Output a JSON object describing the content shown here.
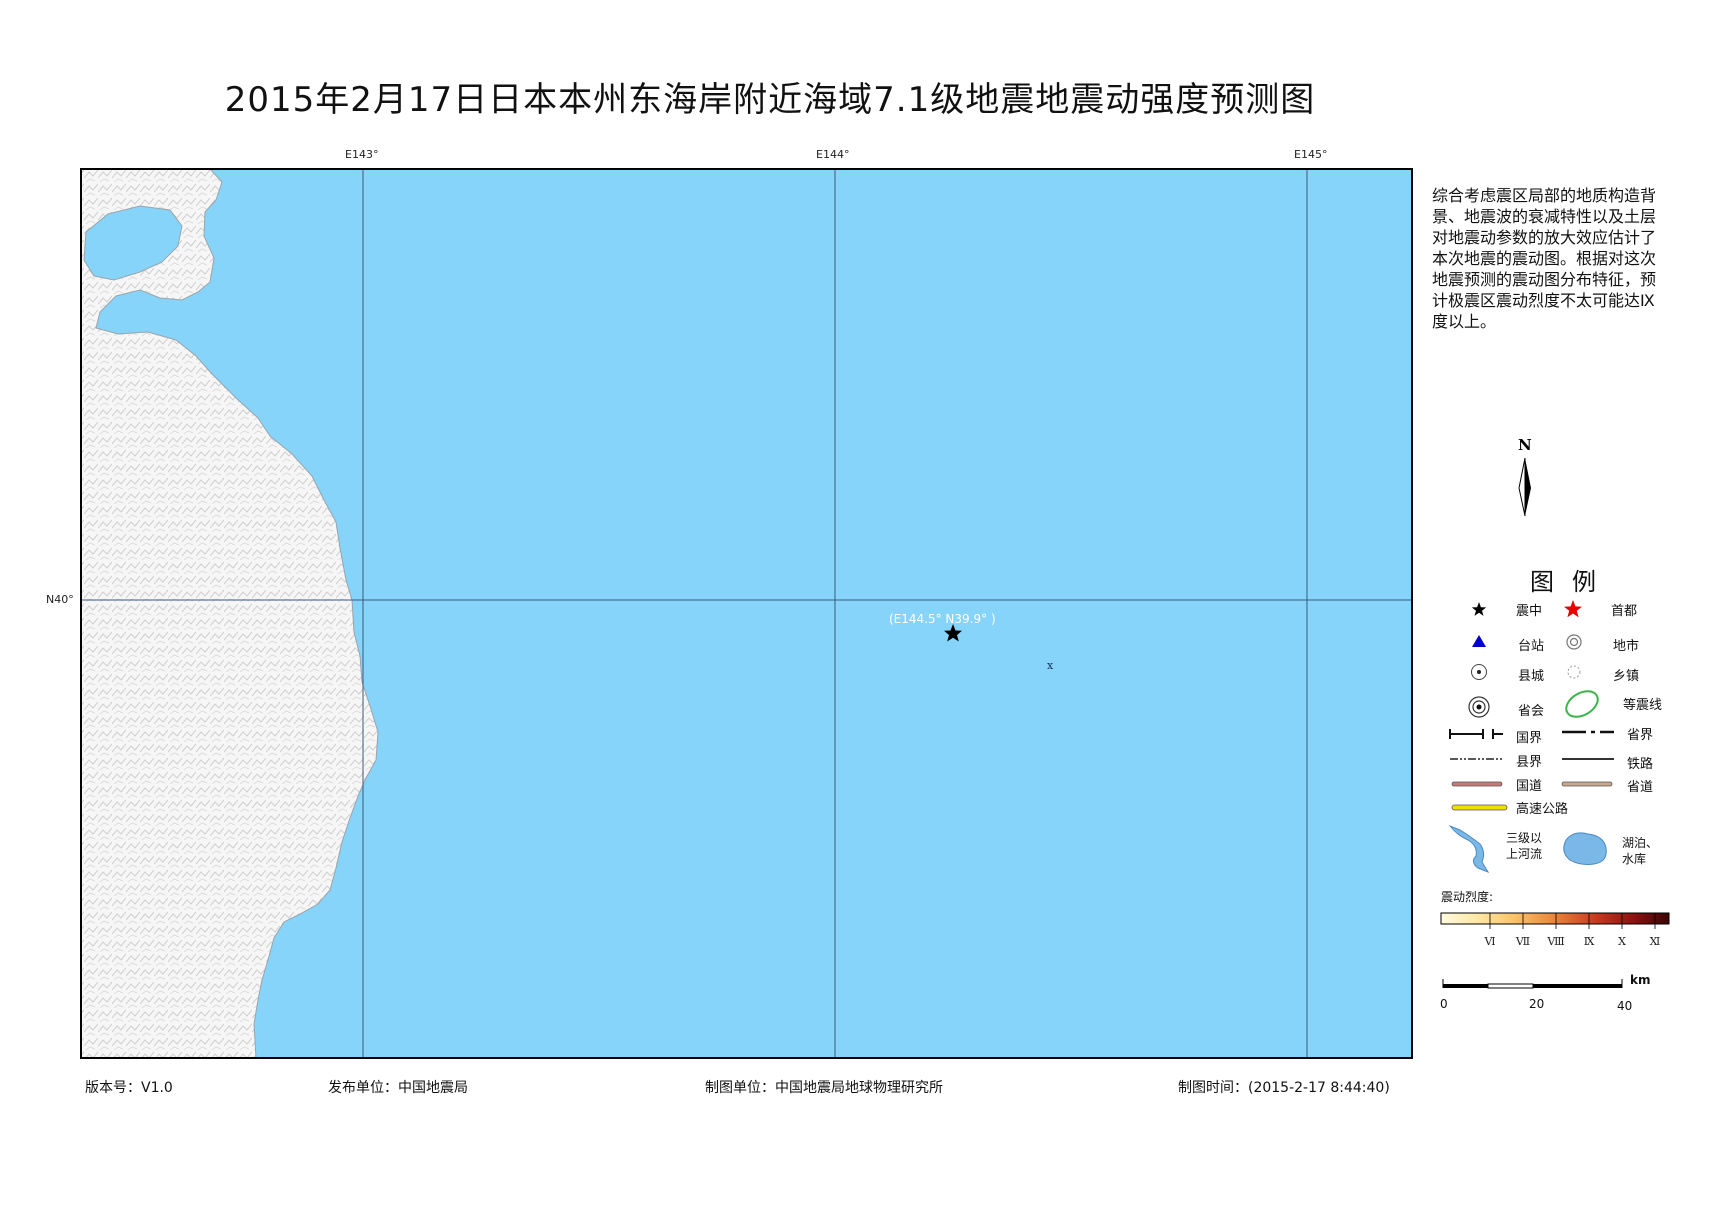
{
  "title": "2015年2月17日日本本州东海岸附近海域7.1级地震地震动强度预测图",
  "graticule": {
    "lon_labels": [
      "E143°",
      "E144°",
      "E145°"
    ],
    "lat_labels": [
      "N40°"
    ]
  },
  "epicenter": {
    "label": "(E144.5° N39.9° )",
    "lon": 144.5,
    "lat": 39.9,
    "marker": "x"
  },
  "colors": {
    "sea": "#87d4fa",
    "land": "#f4f4f4",
    "frame": "#000000",
    "grid": "#3a5a80",
    "epicenter_star": "#000000",
    "capital_star": "#e60000",
    "station_triangle": "#0000cc",
    "isoseismal": "#3cb44b",
    "national_road": "#c87a78",
    "provincial_road": "#c8a890",
    "expressway": "#f0e000",
    "river_lake": "#7ab8e8"
  },
  "description": "综合考虑震区局部的地质构造背景、地震波的衰减特性以及土层对地震动参数的放大效应估计了本次地震的震动图。根据对这次地震预测的震动图分布特征，预计极震区震动烈度不太可能达Ⅸ度以上。",
  "north_arrow": "N",
  "legend": {
    "title": "图例",
    "items": {
      "epicenter": "震中",
      "capital": "首都",
      "station": "台站",
      "city": "地市",
      "county": "县城",
      "town": "乡镇",
      "provincial_capital": "省会",
      "isoseismal": "等震线",
      "national_border": "国界",
      "provincial_border": "省界",
      "county_border": "县界",
      "railway": "铁路",
      "national_road": "国道",
      "provincial_road": "省道",
      "expressway": "高速公路",
      "river_line1": "三级以",
      "river_line2": "上河流",
      "lake_line1": "湖泊、",
      "lake_line2": "水库"
    },
    "intensity_title": "震动烈度:",
    "intensity_levels": [
      "Ⅵ",
      "Ⅶ",
      "Ⅷ",
      "Ⅸ",
      "Ⅹ",
      "Ⅺ"
    ],
    "intensity_colors": [
      "#fffbe0",
      "#fde9a8",
      "#fbc46a",
      "#e9843a",
      "#c83a1e",
      "#8a1010",
      "#3a0606"
    ]
  },
  "scale_bar": {
    "unit": "km",
    "ticks": [
      "0",
      "20",
      "40"
    ]
  },
  "footer": {
    "version": "版本号：V1.0",
    "publisher": "发布单位：中国地震局",
    "maker": "制图单位：中国地震局地球物理研究所",
    "time": "制图时间：(2015-2-17 8:44:40)"
  }
}
